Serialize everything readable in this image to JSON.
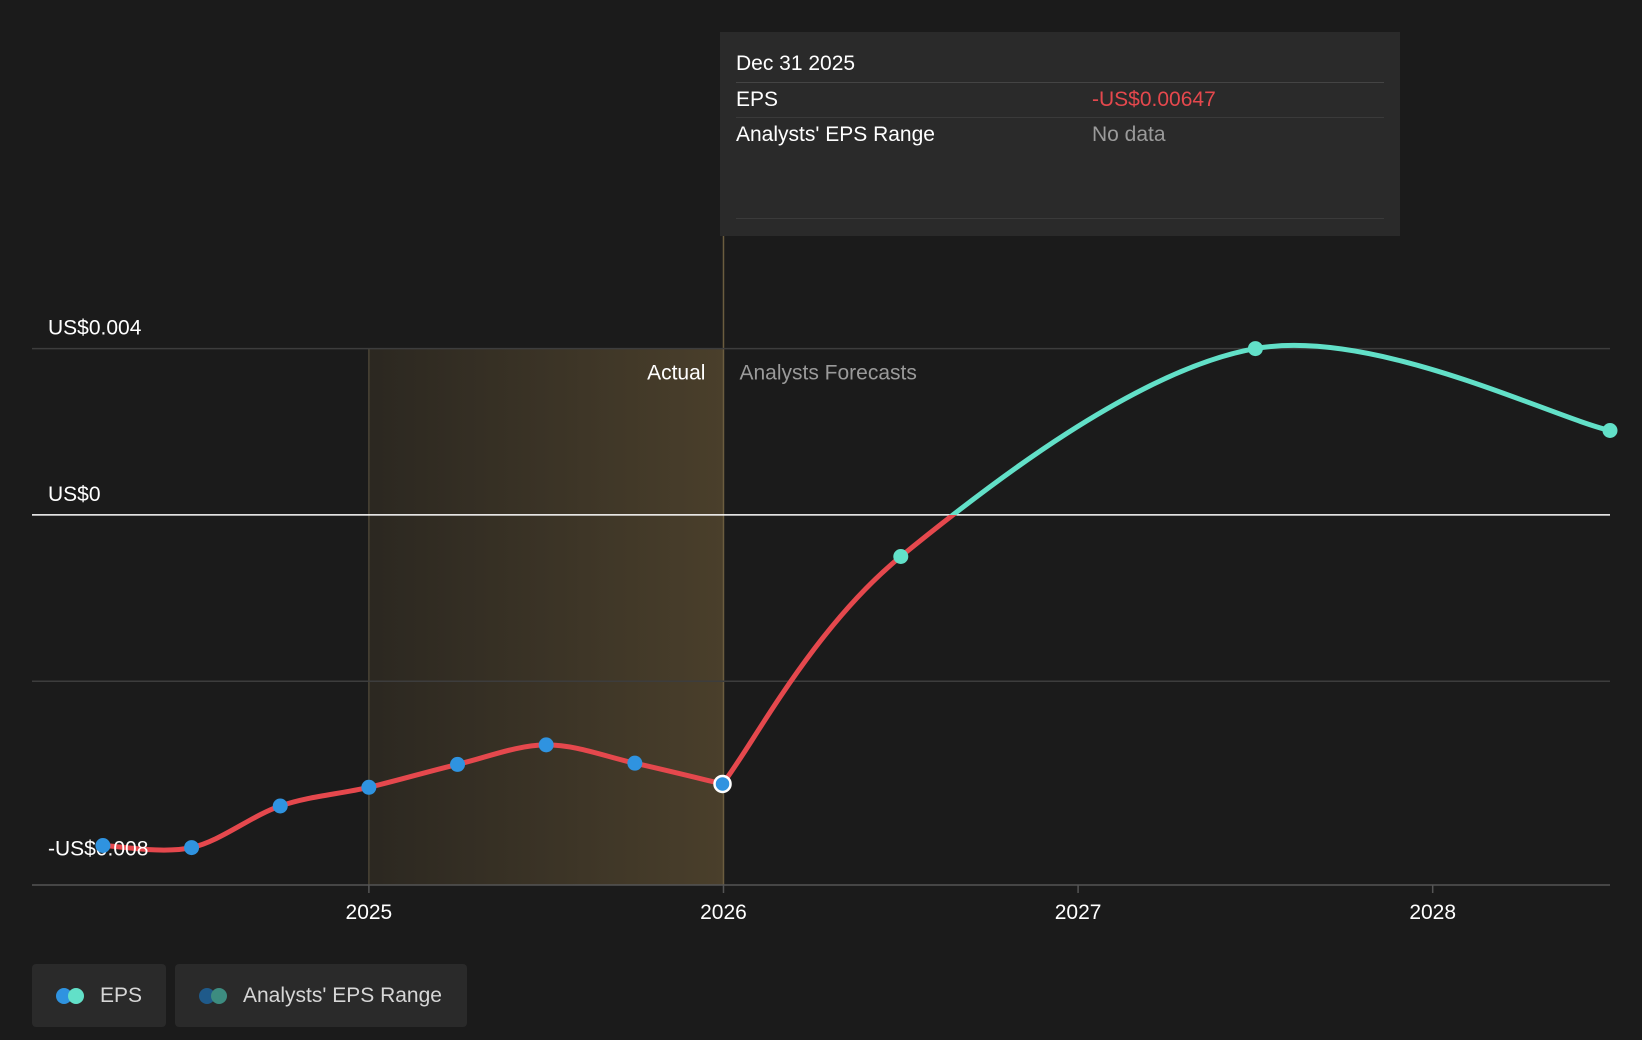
{
  "tooltip": {
    "date": "Dec 31 2025",
    "rows": [
      {
        "label": "EPS",
        "value": "-US$0.00647"
      },
      {
        "label": "Analysts' EPS Range",
        "value": "No data"
      }
    ]
  },
  "legend": {
    "items": [
      {
        "label": "EPS"
      },
      {
        "label": "Analysts' EPS Range"
      }
    ]
  },
  "colors": {
    "background": "#1b1b1b",
    "actual_line": "#e5484d",
    "actual_points": "#2f93e0",
    "forecast_line": "#62e0c8",
    "shade": "#4a3f2b",
    "grid": "#3d3d3d",
    "zero_line": "#ffffff",
    "range_dot_1": "#1f5a8a",
    "range_dot_2": "#3d8c80"
  },
  "chart_data": {
    "type": "line",
    "y_axis": {
      "labels": [
        "US$0.004",
        "US$0",
        "-US$0.008"
      ],
      "ticks": [
        0.004,
        0,
        -0.008
      ]
    },
    "x_axis": {
      "labels": [
        "2025",
        "2026",
        "2027",
        "2028"
      ],
      "ticks": [
        2025,
        2026,
        2027,
        2028
      ]
    },
    "xlim": [
      2024.05,
      2028.5
    ],
    "ylim": [
      -0.0089,
      0.0069
    ],
    "regions": [
      {
        "label": "Actual",
        "from": 2025.0,
        "to": 2026.0
      },
      {
        "label": "Analysts Forecasts",
        "from": 2026.0
      }
    ],
    "series": [
      {
        "name": "EPS",
        "kind": "actual",
        "points": [
          {
            "x": 2024.25,
            "y": -0.00795
          },
          {
            "x": 2024.5,
            "y": -0.008
          },
          {
            "x": 2024.75,
            "y": -0.007
          },
          {
            "x": 2025.0,
            "y": -0.00655
          },
          {
            "x": 2025.25,
            "y": -0.006
          },
          {
            "x": 2025.5,
            "y": -0.00553
          },
          {
            "x": 2025.75,
            "y": -0.00597
          },
          {
            "x": 2025.9973,
            "y": -0.00647
          }
        ]
      },
      {
        "name": "EPS",
        "kind": "forecast",
        "points": [
          {
            "x": 2025.9973,
            "y": -0.00647
          },
          {
            "x": 2026.5,
            "y": -0.001
          },
          {
            "x": 2027.5,
            "y": 0.004
          },
          {
            "x": 2028.5,
            "y": 0.00203
          }
        ]
      }
    ],
    "highlight": {
      "x": 2025.9973,
      "y": -0.00647
    }
  }
}
